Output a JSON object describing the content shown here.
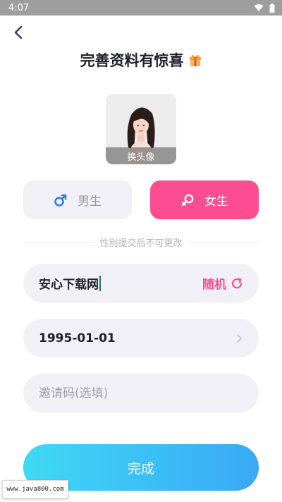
{
  "status_bar": {
    "time": "4:07"
  },
  "header": {
    "title": "完善资料有惊喜"
  },
  "avatar": {
    "caption": "换头像"
  },
  "gender": {
    "male_label": "男生",
    "female_label": "女生",
    "selected": "female",
    "hint": "性别提交后不可更改"
  },
  "nickname": {
    "value": "安心下载网",
    "random_label": "随机"
  },
  "birthday": {
    "value": "1995-01-01"
  },
  "invite": {
    "placeholder": "邀请码(选填)"
  },
  "done_label": "完成",
  "watermark": "www.java800.com",
  "colors": {
    "accent_pink": "#fc4d91",
    "accent_blue": "#3aa8f7",
    "field_bg": "#f1f0f6"
  }
}
